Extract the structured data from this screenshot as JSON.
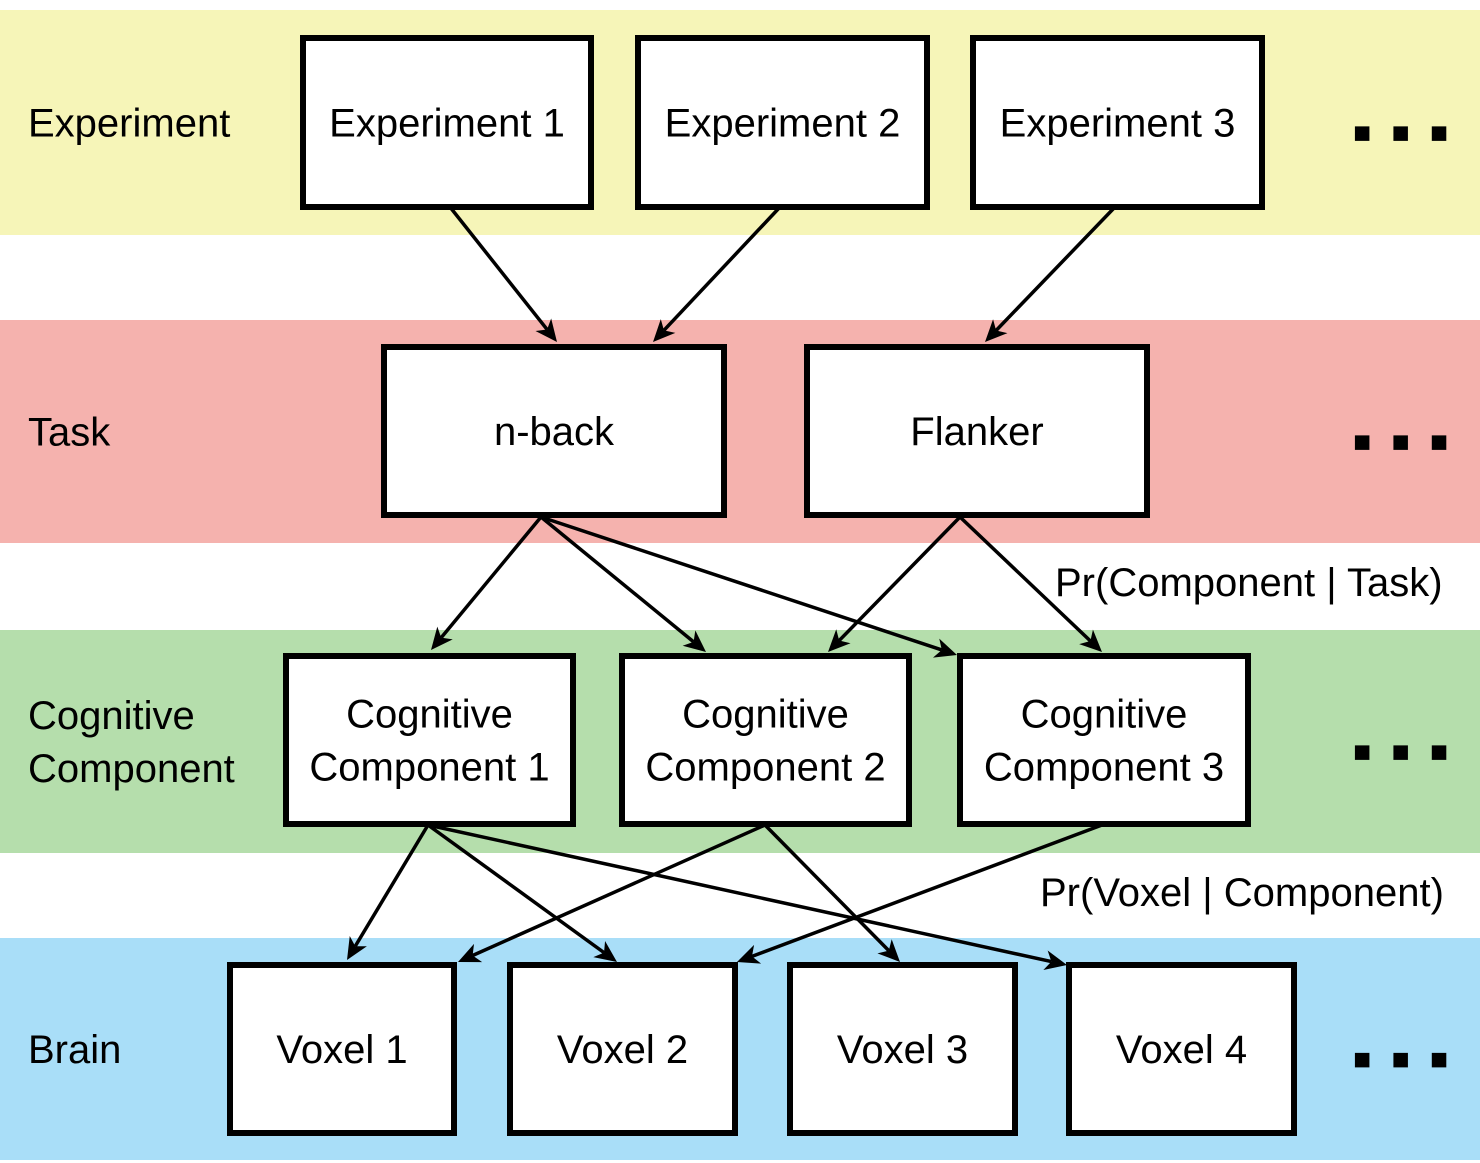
{
  "bands": [
    {
      "id": "experiment",
      "label_lines": [
        "Experiment"
      ],
      "color": "#f6f5b8",
      "ellipsis": "■ ■ ■",
      "nodes": [
        "Experiment 1",
        "Experiment 2",
        "Experiment 3"
      ]
    },
    {
      "id": "task",
      "label_lines": [
        "Task"
      ],
      "color": "#f5b2ae",
      "ellipsis": "■ ■ ■",
      "nodes": [
        "n-back",
        "Flanker"
      ]
    },
    {
      "id": "component",
      "label_lines": [
        "Cognitive",
        "Component"
      ],
      "color": "#b5deac",
      "ellipsis": "■ ■ ■",
      "nodes": [
        [
          "Cognitive",
          "Component 1"
        ],
        [
          "Cognitive",
          "Component 2"
        ],
        [
          "Cognitive",
          "Component 3"
        ]
      ]
    },
    {
      "id": "brain",
      "label_lines": [
        "Brain"
      ],
      "color": "#a9def8",
      "ellipsis": "■ ■ ■",
      "nodes": [
        "Voxel 1",
        "Voxel 2",
        "Voxel 3",
        "Voxel 4"
      ]
    }
  ],
  "edges": [
    [
      "Experiment 1",
      "n-back"
    ],
    [
      "Experiment 2",
      "n-back"
    ],
    [
      "Experiment 3",
      "Flanker"
    ],
    [
      "n-back",
      "Cognitive Component 1"
    ],
    [
      "n-back",
      "Cognitive Component 2"
    ],
    [
      "n-back",
      "Cognitive Component 3"
    ],
    [
      "Flanker",
      "Cognitive Component 2"
    ],
    [
      "Flanker",
      "Cognitive Component 3"
    ],
    [
      "Cognitive Component 1",
      "Voxel 1"
    ],
    [
      "Cognitive Component 1",
      "Voxel 2"
    ],
    [
      "Cognitive Component 1",
      "Voxel 4"
    ],
    [
      "Cognitive Component 2",
      "Voxel 1"
    ],
    [
      "Cognitive Component 2",
      "Voxel 3"
    ],
    [
      "Cognitive Component 3",
      "Voxel 2"
    ]
  ],
  "annotations": {
    "task_to_component": "Pr(Component | Task)",
    "component_to_voxel": "Pr(Voxel | Component)"
  }
}
